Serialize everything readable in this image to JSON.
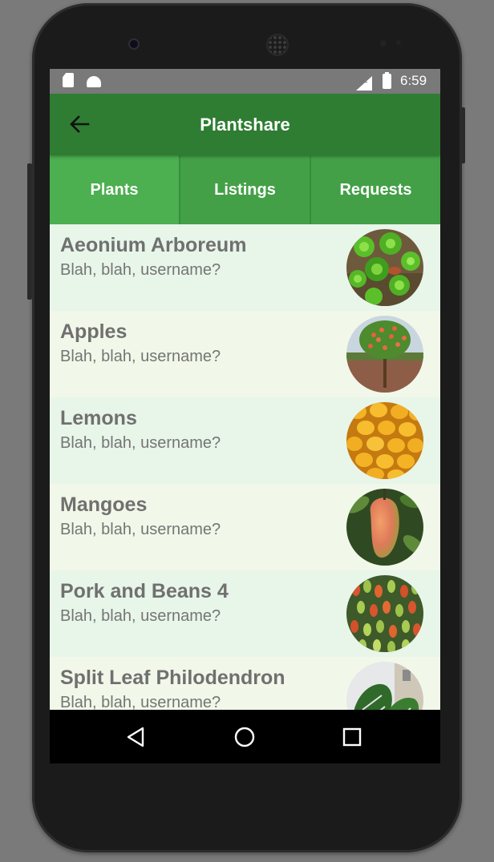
{
  "status_bar": {
    "time": "6:59",
    "icons": [
      "sd-card-icon",
      "android-icon",
      "lte-signal-icon",
      "battery-icon"
    ],
    "network": "LTE"
  },
  "app_bar": {
    "title": "Plantshare",
    "back_icon": "arrow-back-icon"
  },
  "tabs": [
    {
      "label": "Plants",
      "active": true
    },
    {
      "label": "Listings",
      "active": false
    },
    {
      "label": "Requests",
      "active": false
    }
  ],
  "items": [
    {
      "title": "Aeonium Arboreum",
      "subtitle": "Blah, blah, username?",
      "image": "succulent-photo"
    },
    {
      "title": "Apples",
      "subtitle": "Blah, blah, username?",
      "image": "apple-tree-photo"
    },
    {
      "title": "Lemons",
      "subtitle": "Blah, blah, username?",
      "image": "lemons-photo"
    },
    {
      "title": "Mangoes",
      "subtitle": "Blah, blah, username?",
      "image": "mango-photo"
    },
    {
      "title": "Pork and Beans 4",
      "subtitle": "Blah, blah, username?",
      "image": "sedum-photo"
    },
    {
      "title": "Split Leaf Philodendron",
      "subtitle": "Blah, blah, username?",
      "image": "philodendron-photo"
    }
  ],
  "nav_bar": {
    "buttons": [
      "back-triangle-icon",
      "home-circle-icon",
      "recents-square-icon"
    ]
  },
  "colors": {
    "primary_dark": "#2e7d32",
    "primary": "#4caf50",
    "tab_inactive": "#43a047",
    "row_odd": "#e8f5e9",
    "row_even": "#f1f8e9"
  }
}
